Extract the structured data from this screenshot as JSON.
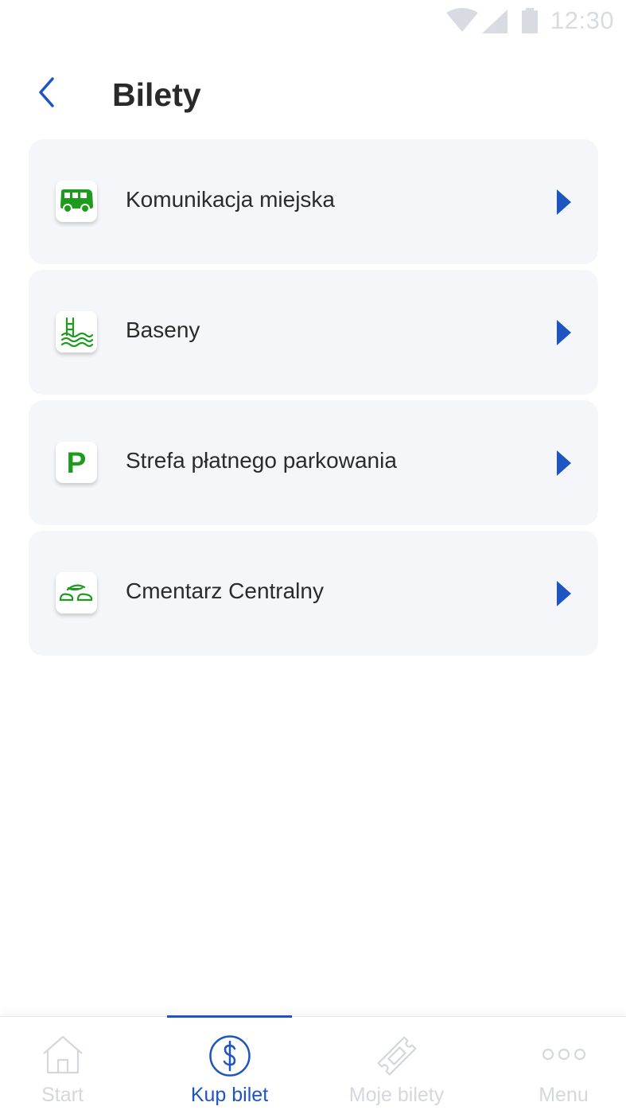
{
  "status_bar": {
    "time": "12:30",
    "icons": [
      "wifi-icon",
      "signal-icon",
      "battery-icon"
    ]
  },
  "header": {
    "title": "Bilety",
    "back_icon": "chevron-left-icon"
  },
  "categories": [
    {
      "label": "Komunikacja miejska",
      "icon": "bus-icon"
    },
    {
      "label": "Baseny",
      "icon": "pool-icon"
    },
    {
      "label": "Strefa płatnego parkowania",
      "icon": "parking-icon",
      "icon_text": "P"
    },
    {
      "label": "Cmentarz Centralny",
      "icon": "cemetery-leaves-icon"
    }
  ],
  "bottom_nav": {
    "active_index": 1,
    "items": [
      {
        "label": "Start",
        "icon": "home-icon"
      },
      {
        "label": "Kup bilet",
        "icon": "dollar-circle-icon"
      },
      {
        "label": "Moje bilety",
        "icon": "ticket-icon"
      },
      {
        "label": "Menu",
        "icon": "more-dots-icon"
      }
    ]
  },
  "colors": {
    "accent": "#1e55c0",
    "icon_green": "#1e9b1e",
    "card_bg": "#f5f6f9",
    "inactive": "#d4d7dd"
  }
}
